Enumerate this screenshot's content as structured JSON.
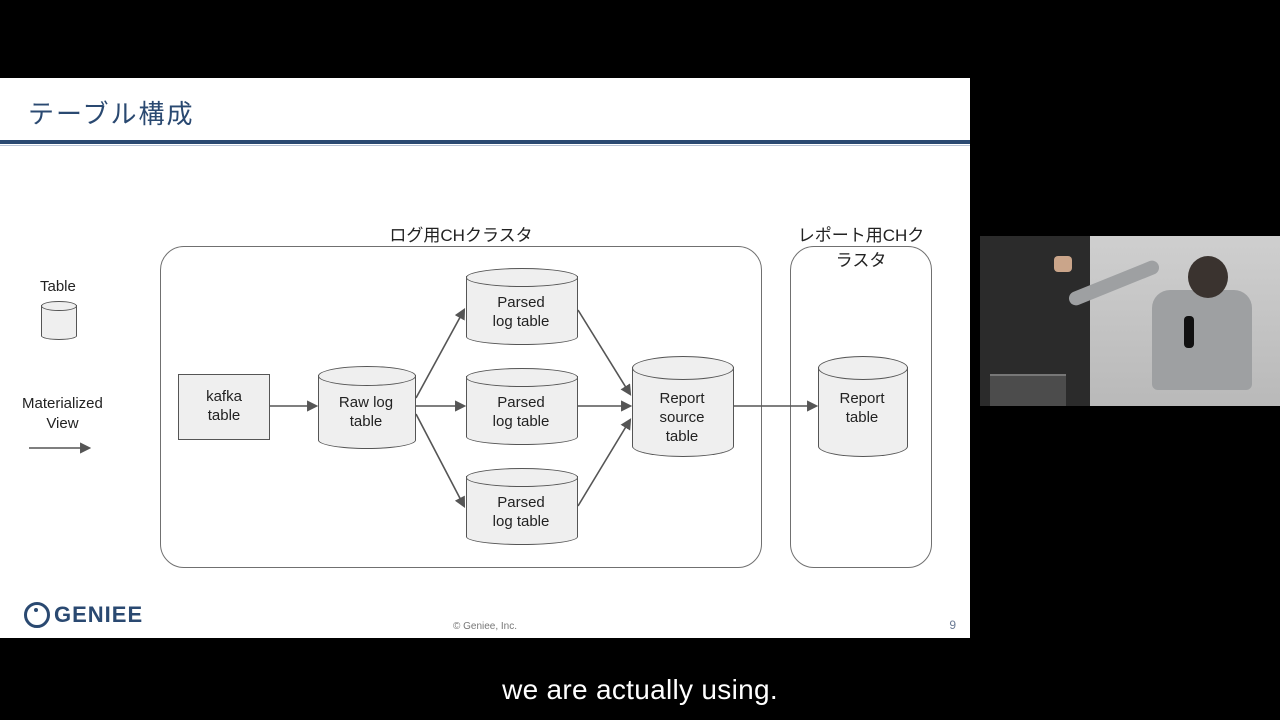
{
  "slide": {
    "title": "テーブル構成",
    "page_number": "9",
    "copyright": "© Geniee, Inc.",
    "logo_text": "GENIEE"
  },
  "legend": {
    "table_label": "Table",
    "mv_label_line1": "Materialized",
    "mv_label_line2": "View"
  },
  "clusters": {
    "log": {
      "label": "ログ用CHクラスタ"
    },
    "report": {
      "label": "レポート用CHクラスタ"
    }
  },
  "nodes": {
    "kafka": {
      "line1": "kafka",
      "line2": "table"
    },
    "raw_log": {
      "line1": "Raw log",
      "line2": "table"
    },
    "parsed_1": {
      "line1": "Parsed",
      "line2": "log table"
    },
    "parsed_2": {
      "line1": "Parsed",
      "line2": "log table"
    },
    "parsed_3": {
      "line1": "Parsed",
      "line2": "log table"
    },
    "report_source": {
      "line1": "Report",
      "line2": "source",
      "line3": "table"
    },
    "report": {
      "line1": "Report",
      "line2": "table"
    }
  },
  "subtitle": "we are actually using."
}
